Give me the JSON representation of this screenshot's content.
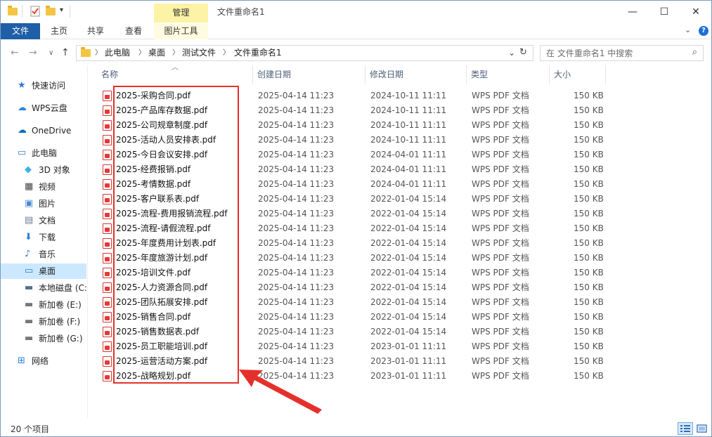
{
  "window": {
    "title": "文件重命名1",
    "context_tab": "管理",
    "buttons": {
      "minimize": "—",
      "maximize": "☐",
      "close": "✕"
    }
  },
  "ribbon": {
    "tabs": [
      "文件",
      "主页",
      "共享",
      "查看",
      "图片工具"
    ]
  },
  "address": {
    "crumbs": [
      "此电脑",
      "桌面",
      "测试文件",
      "文件重命名1"
    ],
    "search_placeholder": "在 文件重命名1 中搜索"
  },
  "nav": {
    "items": [
      {
        "label": "快速访问",
        "icon": "star-icon"
      },
      {
        "label": "WPS云盘",
        "icon": "cloud-icon"
      },
      {
        "label": "OneDrive",
        "icon": "onedrive-cloud-icon"
      },
      {
        "label": "此电脑",
        "icon": "computer-icon"
      },
      {
        "label": "3D 对象",
        "icon": "cube-icon"
      },
      {
        "label": "视频",
        "icon": "film-icon"
      },
      {
        "label": "图片",
        "icon": "picture-icon"
      },
      {
        "label": "文档",
        "icon": "document-icon"
      },
      {
        "label": "下载",
        "icon": "download-arrow-icon"
      },
      {
        "label": "音乐",
        "icon": "music-note-icon"
      },
      {
        "label": "桌面",
        "icon": "desktop-icon"
      },
      {
        "label": "本地磁盘 (C:)",
        "icon": "drive-c-icon"
      },
      {
        "label": "新加卷 (E:)",
        "icon": "drive-icon"
      },
      {
        "label": "新加卷 (F:)",
        "icon": "drive-icon"
      },
      {
        "label": "新加卷 (G:)",
        "icon": "drive-icon"
      },
      {
        "label": "网络",
        "icon": "network-icon"
      }
    ],
    "selected": "桌面"
  },
  "columns": {
    "name": "名称",
    "created": "创建日期",
    "modified": "修改日期",
    "type": "类型",
    "size": "大小"
  },
  "files": [
    {
      "name": "2025-采购合同.pdf",
      "created": "2025-04-14 11:23",
      "modified": "2024-10-11 11:11",
      "type": "WPS PDF 文档",
      "size": "150 KB"
    },
    {
      "name": "2025-产品库存数据.pdf",
      "created": "2025-04-14 11:23",
      "modified": "2024-10-11 11:11",
      "type": "WPS PDF 文档",
      "size": "150 KB"
    },
    {
      "name": "2025-公司规章制度.pdf",
      "created": "2025-04-14 11:23",
      "modified": "2024-10-11 11:11",
      "type": "WPS PDF 文档",
      "size": "150 KB"
    },
    {
      "name": "2025-活动人员安排表.pdf",
      "created": "2025-04-14 11:23",
      "modified": "2024-10-11 11:11",
      "type": "WPS PDF 文档",
      "size": "150 KB"
    },
    {
      "name": "2025-今日会议安排.pdf",
      "created": "2025-04-14 11:23",
      "modified": "2024-04-01 11:11",
      "type": "WPS PDF 文档",
      "size": "150 KB"
    },
    {
      "name": "2025-经费报销.pdf",
      "created": "2025-04-14 11:23",
      "modified": "2024-04-01 11:11",
      "type": "WPS PDF 文档",
      "size": "150 KB"
    },
    {
      "name": "2025-考情数据.pdf",
      "created": "2025-04-14 11:23",
      "modified": "2024-04-01 11:11",
      "type": "WPS PDF 文档",
      "size": "150 KB"
    },
    {
      "name": "2025-客户联系表.pdf",
      "created": "2025-04-14 11:23",
      "modified": "2022-01-04 15:14",
      "type": "WPS PDF 文档",
      "size": "150 KB"
    },
    {
      "name": "2025-流程-费用报销流程.pdf",
      "created": "2025-04-14 11:23",
      "modified": "2022-01-04 15:14",
      "type": "WPS PDF 文档",
      "size": "150 KB"
    },
    {
      "name": "2025-流程-请假流程.pdf",
      "created": "2025-04-14 11:23",
      "modified": "2022-01-04 15:14",
      "type": "WPS PDF 文档",
      "size": "150 KB"
    },
    {
      "name": "2025-年度费用计划表.pdf",
      "created": "2025-04-14 11:23",
      "modified": "2022-01-04 15:14",
      "type": "WPS PDF 文档",
      "size": "150 KB"
    },
    {
      "name": "2025-年度旅游计划.pdf",
      "created": "2025-04-14 11:23",
      "modified": "2022-01-04 15:14",
      "type": "WPS PDF 文档",
      "size": "150 KB"
    },
    {
      "name": "2025-培训文件.pdf",
      "created": "2025-04-14 11:23",
      "modified": "2022-01-04 15:14",
      "type": "WPS PDF 文档",
      "size": "150 KB"
    },
    {
      "name": "2025-人力资源合同.pdf",
      "created": "2025-04-14 11:23",
      "modified": "2022-01-04 15:14",
      "type": "WPS PDF 文档",
      "size": "150 KB"
    },
    {
      "name": "2025-团队拓展安排.pdf",
      "created": "2025-04-14 11:23",
      "modified": "2022-01-04 15:14",
      "type": "WPS PDF 文档",
      "size": "150 KB"
    },
    {
      "name": "2025-销售合同.pdf",
      "created": "2025-04-14 11:23",
      "modified": "2022-01-04 15:14",
      "type": "WPS PDF 文档",
      "size": "150 KB"
    },
    {
      "name": "2025-销售数据表.pdf",
      "created": "2025-04-14 11:23",
      "modified": "2022-01-04 15:14",
      "type": "WPS PDF 文档",
      "size": "150 KB"
    },
    {
      "name": "2025-员工职能培训.pdf",
      "created": "2025-04-14 11:23",
      "modified": "2023-01-01 11:11",
      "type": "WPS PDF 文档",
      "size": "150 KB"
    },
    {
      "name": "2025-运营活动方案.pdf",
      "created": "2025-04-14 11:23",
      "modified": "2023-01-01 11:11",
      "type": "WPS PDF 文档",
      "size": "150 KB"
    },
    {
      "name": "2025-战略规划.pdf",
      "created": "2025-04-14 11:23",
      "modified": "2023-01-01 11:11",
      "type": "WPS PDF 文档",
      "size": "150 KB"
    }
  ],
  "status": {
    "count": "20 个项目"
  },
  "colors": {
    "accent": "#1f5fa7",
    "selected": "#cce8ff",
    "highlight": "#e4302c",
    "manage_tab": "#fdf3a7"
  }
}
